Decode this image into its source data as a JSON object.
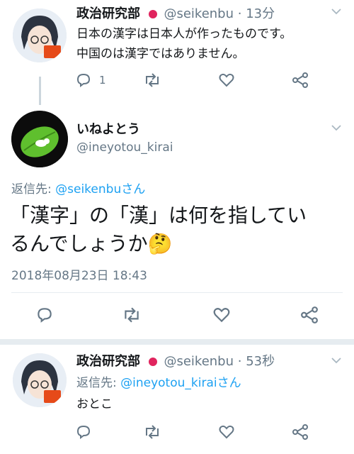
{
  "colors": {
    "accent": "#1da1f2",
    "muted": "#657786",
    "divider": "#e6ecf0",
    "flag": "#e0245e"
  },
  "tweet1": {
    "display_name": "政治研究部",
    "handle": "@seikenbu",
    "separator": "·",
    "time": "13分",
    "text_line1": "日本の漢字は日本人が作ったものです。",
    "text_line2": "中国のは漢字ではありません。",
    "reply_count": "1",
    "icons": [
      "reply-icon",
      "retweet-icon",
      "like-icon",
      "share-icon"
    ]
  },
  "main": {
    "display_name": "いねよとう",
    "handle": "@ineyotou_kirai",
    "reply_prefix": "返信先:",
    "reply_to": "@seikenbu",
    "reply_suffix": "さん",
    "text_line1": "「漢字」の「漢」は何を指してい",
    "text_line2": "るんでしょうか",
    "emoji": "🤔",
    "timestamp": "2018年08月23日 18:43",
    "icons": [
      "reply-icon",
      "retweet-icon",
      "like-icon",
      "share-icon"
    ]
  },
  "tweet3": {
    "display_name": "政治研究部",
    "handle": "@seikenbu",
    "separator": "·",
    "time": "53秒",
    "reply_prefix": "返信先:",
    "reply_to": "@ineyotou_kirai",
    "reply_suffix": "さん",
    "text": "おとこ",
    "icons": [
      "reply-icon",
      "retweet-icon",
      "like-icon",
      "share-icon"
    ]
  }
}
